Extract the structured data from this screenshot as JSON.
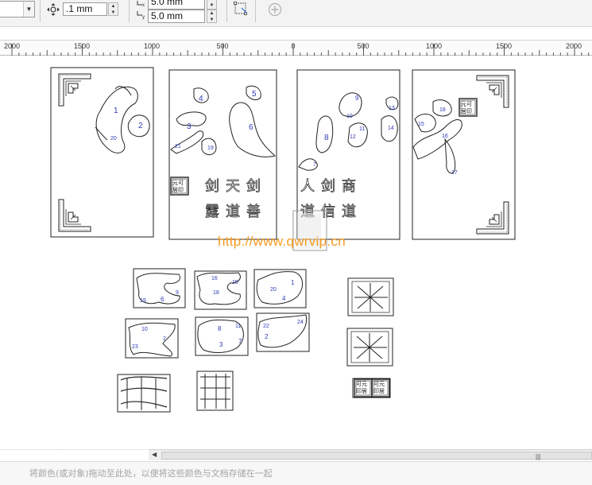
{
  "propbar": {
    "nudge_value": ".1 mm",
    "dup_x_value": "5.0 mm",
    "dup_y_value": "5.0 mm"
  },
  "ruler": {
    "labels": [
      "2000",
      "1500",
      "1000",
      "500",
      "0",
      "500",
      "1000",
      "1500",
      "2000"
    ]
  },
  "canvas": {
    "watermark": "http://www.qwrvip.cn",
    "seal_text": "元可居印",
    "calligraphy_row1_left": "剑天剑",
    "calligraphy_row2_left": "露道善",
    "calligraphy_row1_right": "人剑商",
    "calligraphy_row2_right": "道信道",
    "piece_numbers_panel1": [
      "1",
      "2",
      "20"
    ],
    "piece_numbers_panel2": [
      "3",
      "4",
      "5",
      "6",
      "19",
      "21"
    ],
    "piece_numbers_panel3": [
      "7",
      "8",
      "9",
      "10",
      "11",
      "12",
      "13",
      "14"
    ],
    "piece_numbers_panel4": [
      "15",
      "16",
      "17",
      "18"
    ],
    "part_labels_row1": [
      "19",
      "6",
      "9",
      "16",
      "15",
      "18",
      "20",
      "4",
      "1"
    ],
    "part_labels_row2": [
      "23",
      "10",
      "2",
      "11",
      "8",
      "3",
      "7",
      "22",
      "2",
      "24"
    ]
  },
  "statusbar": {
    "palette_hint": "将颜色(或对象)拖动至此处，以便将这些颜色与文档存储在一起"
  }
}
